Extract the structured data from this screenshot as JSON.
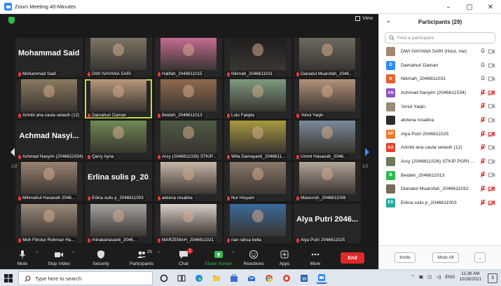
{
  "window": {
    "title": "Zoom Meeting 40-Minutes",
    "controls": [
      "–",
      "▢",
      "✕"
    ]
  },
  "video": {
    "view_label": "View",
    "pager_left": "1/2",
    "pager_right": "1/2",
    "tiles": [
      {
        "name": "Mohammad Said.",
        "big": "Mohammad Said.",
        "photo": "#2b2b2b"
      },
      {
        "name": "DWI IVAYANA SARI",
        "photo": "#7a7565"
      },
      {
        "name": "Halifah_2046611015",
        "photo": "#c56b92"
      },
      {
        "name": "Nikmah_2046611031",
        "photo": "#1e1e1e"
      },
      {
        "name": "Dianatul Muarofah_2046...",
        "photo": "#6e6a60"
      },
      {
        "name": "Arimbi ana caula selasih (12)",
        "photo": "#8a7a60"
      },
      {
        "name": "Damahuri Daman",
        "photo": "#b8977a",
        "selected": true
      },
      {
        "name": "Beideh_2046611013",
        "photo": "#8f6a4d"
      },
      {
        "name": "Lulu Faiqda",
        "photo": "#7d9a80"
      },
      {
        "name": "'Ainul Yaqin",
        "photo": "#b3927a"
      },
      {
        "name": "Achmad Nasyim (2046611034)",
        "big": "Achmad Nasyi...",
        "photo": "#2b2b2b"
      },
      {
        "name": "Qarry Ayna",
        "photo": "#6f8a55"
      },
      {
        "name": "Arsy (2046611026) STKIP...",
        "photo": "#4d5a44"
      },
      {
        "name": "Wita Damayanti_2046611...",
        "photo": "#a89a40"
      },
      {
        "name": "Ummi Hasanah_2046...",
        "photo": "#7a8a9a"
      },
      {
        "name": "Mihmahul Hasanah 2046...",
        "photo": "#9a8270"
      },
      {
        "name": "Erlina sulis p_2046611003",
        "big": "Erlina sulis p_20...",
        "photo": "#2b2b2b"
      },
      {
        "name": "alviena rosalina",
        "photo": "#c8b8a8"
      },
      {
        "name": "Nur Hisyam",
        "photo": "#8a7868"
      },
      {
        "name": "Masruroh_2046611006",
        "photo": "#b2a598"
      },
      {
        "name": "Moh Fitrotur Rohman Ha...",
        "photo": "#9a8a7a"
      },
      {
        "name": "rhinakartavanti_2046...",
        "photo": "#a6a29e"
      },
      {
        "name": "MARZEMAH_2046611021",
        "photo": "#d8d0c8"
      },
      {
        "name": "rian rahsa bella",
        "photo": "#3a6a9a"
      },
      {
        "name": "Alya Putri 2046611025",
        "big": "Alya Putri 2046...",
        "photo": "#2b2b2b"
      }
    ]
  },
  "toolbar": {
    "mute": "Mute",
    "stop_video": "Stop Video",
    "security": "Security",
    "participants": "Participants",
    "participants_count": "29",
    "chat": "Chat",
    "chat_badge": "1",
    "share_screen": "Share Screen",
    "reactions": "Reactions",
    "apps": "Apps",
    "more": "More",
    "end": "End"
  },
  "participants_panel": {
    "title": "Participants (29)",
    "search_placeholder": "Find a participant",
    "items": [
      {
        "name": "DWI IVAYANA SARI (Host, me)",
        "initials": "",
        "color": "#a08870",
        "muted": false,
        "video": true
      },
      {
        "name": "Damahuri Daman",
        "initials": "D",
        "color": "#2d8cff",
        "muted": false,
        "video": true
      },
      {
        "name": "Nikmah_2046611031",
        "initials": "N",
        "color": "#e8612c",
        "muted": false,
        "video": true
      },
      {
        "name": "Achmad Nasyim (2046611034)",
        "initials": "AN",
        "color": "#8e4fc8",
        "muted": true,
        "video": false
      },
      {
        "name": "'Ainul Yaqin",
        "initials": "",
        "color": "#9a8a78",
        "muted": true,
        "video": true
      },
      {
        "name": "alviena rosalina",
        "initials": "",
        "color": "#2b2b2b",
        "muted": true,
        "video": true
      },
      {
        "name": "Alya Putri 2046611025",
        "initials": "AP",
        "color": "#f07a2a",
        "muted": true,
        "video": false
      },
      {
        "name": "Arimbi ana caula selasih (12)",
        "initials": "AA",
        "color": "#e8402c",
        "muted": true,
        "video": true
      },
      {
        "name": "Arsy (2046611026) STKIP PGRI ...",
        "initials": "",
        "color": "#6a7a5a",
        "muted": true,
        "video": true
      },
      {
        "name": "Beideh_2046611013",
        "initials": "B",
        "color": "#2dbb4e",
        "muted": true,
        "video": true
      },
      {
        "name": "Dianatul Muarofah_2046611032",
        "initials": "",
        "color": "#7a6a58",
        "muted": true,
        "video": false
      },
      {
        "name": "Erlina sulis p_2046611003",
        "initials": "ES",
        "color": "#1fae9a",
        "muted": true,
        "video": false
      }
    ],
    "invite": "Invite",
    "mute_all": "Mute All",
    "more": "..."
  },
  "taskbar": {
    "search_placeholder": "Type here to search",
    "language": "ENG",
    "time": "11:36 AM",
    "date": "10/26/2021",
    "notif_count": "3"
  }
}
